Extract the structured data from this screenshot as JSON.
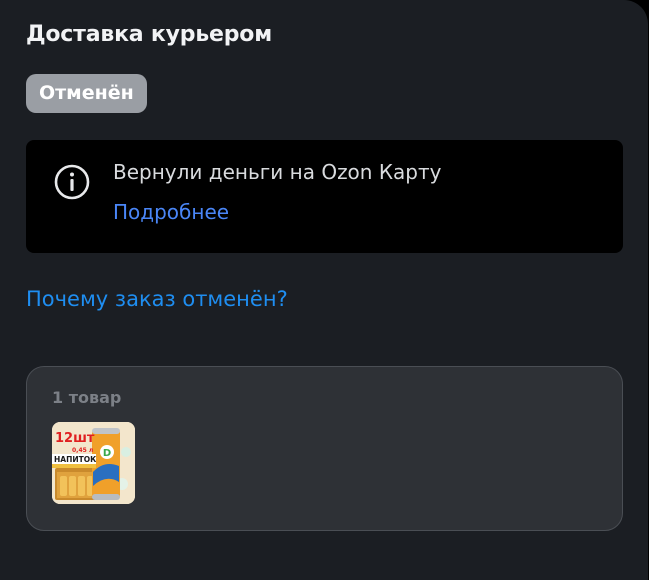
{
  "header": {
    "title": "Доставка курьером"
  },
  "status": {
    "label": "Отменён",
    "color": "#9a9ea4"
  },
  "notice": {
    "icon": "info-icon",
    "text": "Вернули деньги на Ozon Карту",
    "link": "Подробнее"
  },
  "cancel_reason_link": "Почему заказ отменён?",
  "items": {
    "count_label": "1 товар",
    "products": [
      {
        "thumbnail": "drink-can-pack-image",
        "badge_text": "12шт",
        "volume_text": "0,45 л",
        "name_text": "НАПИТОК"
      }
    ]
  },
  "colors": {
    "background": "#1b1e23",
    "link": "#1f8ef1",
    "notice_link": "#4a86f7"
  }
}
